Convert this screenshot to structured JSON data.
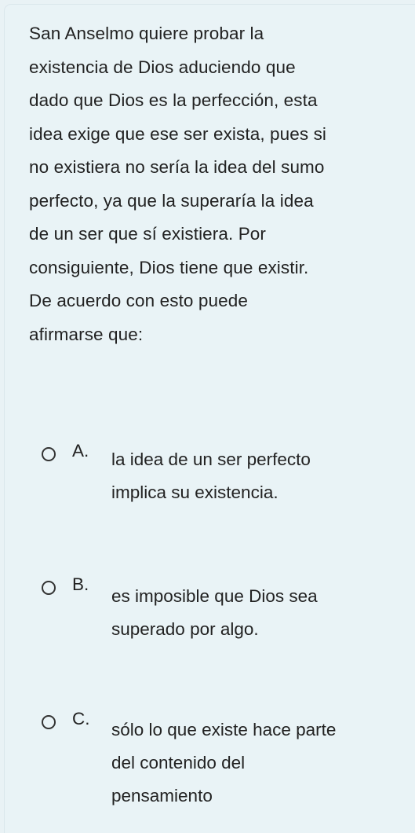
{
  "question": {
    "text": "San Anselmo quiere probar la\nexistencia de Dios aduciendo que\ndado que Dios es la perfección, esta\nidea exige que ese ser exista, pues si\nno existiera no sería la idea del sumo\nperfecto, ya que la superaría la idea\nde un ser que sí  existiera. Por\nconsiguiente, Dios tiene que existir.\nDe acuerdo con esto puede\nafirmarse que:"
  },
  "options": [
    {
      "letter": "A.",
      "text": "la idea de un ser perfecto\nimplica su existencia."
    },
    {
      "letter": "B.",
      "text": "es imposible que Dios sea\nsuperado por algo."
    },
    {
      "letter": "C.",
      "text": "sólo lo que existe hace parte\ndel contenido del\npensamiento"
    }
  ]
}
